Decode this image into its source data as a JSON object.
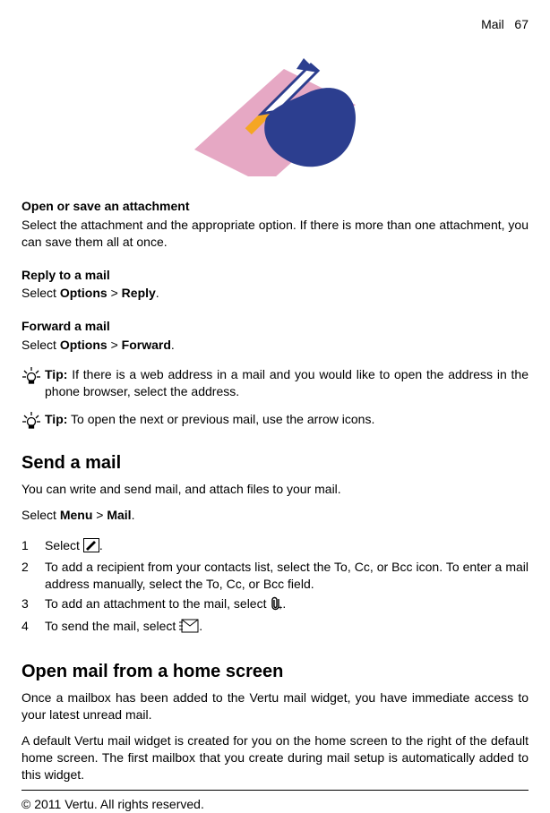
{
  "header": {
    "section": "Mail",
    "page_number": "67"
  },
  "attachment": {
    "title": "Open or save an attachment",
    "body": "Select the attachment and the appropriate option. If there is more than one attachment, you can save them all at once."
  },
  "reply": {
    "title": "Reply to a mail",
    "prefix": "Select ",
    "opt": "Options",
    "sep": " > ",
    "act": "Reply",
    "suffix": "."
  },
  "forward": {
    "title": "Forward a mail",
    "prefix": "Select ",
    "opt": "Options",
    "sep": " > ",
    "act": "Forward",
    "suffix": "."
  },
  "tip1": {
    "label": "Tip:",
    "body": " If there is a web address in a mail and you would like to open the address in the phone browser, select the address."
  },
  "tip2": {
    "label": "Tip:",
    "body": " To open the next or previous mail, use the arrow icons."
  },
  "send": {
    "heading": "Send a mail",
    "intro": "You can write and send mail, and attach files to your mail.",
    "sel_prefix": "Select ",
    "menu": "Menu",
    "sep": " > ",
    "mail": "Mail",
    "suffix": ".",
    "steps": {
      "n1": "1",
      "s1a": "Select ",
      "s1b": ".",
      "n2": "2",
      "s2": "To add a recipient from your contacts list, select the To, Cc, or Bcc icon. To enter a mail address manually, select the To, Cc, or Bcc field.",
      "n3": "3",
      "s3a": "To add an attachment to the mail, select ",
      "s3b": ".",
      "n4": "4",
      "s4a": "To send the mail, select ",
      "s4b": "."
    }
  },
  "home": {
    "heading": "Open mail from a home screen",
    "p1": "Once a mailbox has been added to the Vertu mail widget, you have immediate access to your latest unread mail.",
    "p2": "A default Vertu mail widget is created for you on the home screen to the right of the default home screen. The first mailbox that you create during mail setup is automatically added to this widget."
  },
  "footer": {
    "copyright": "© 2011 Vertu. All rights reserved."
  }
}
